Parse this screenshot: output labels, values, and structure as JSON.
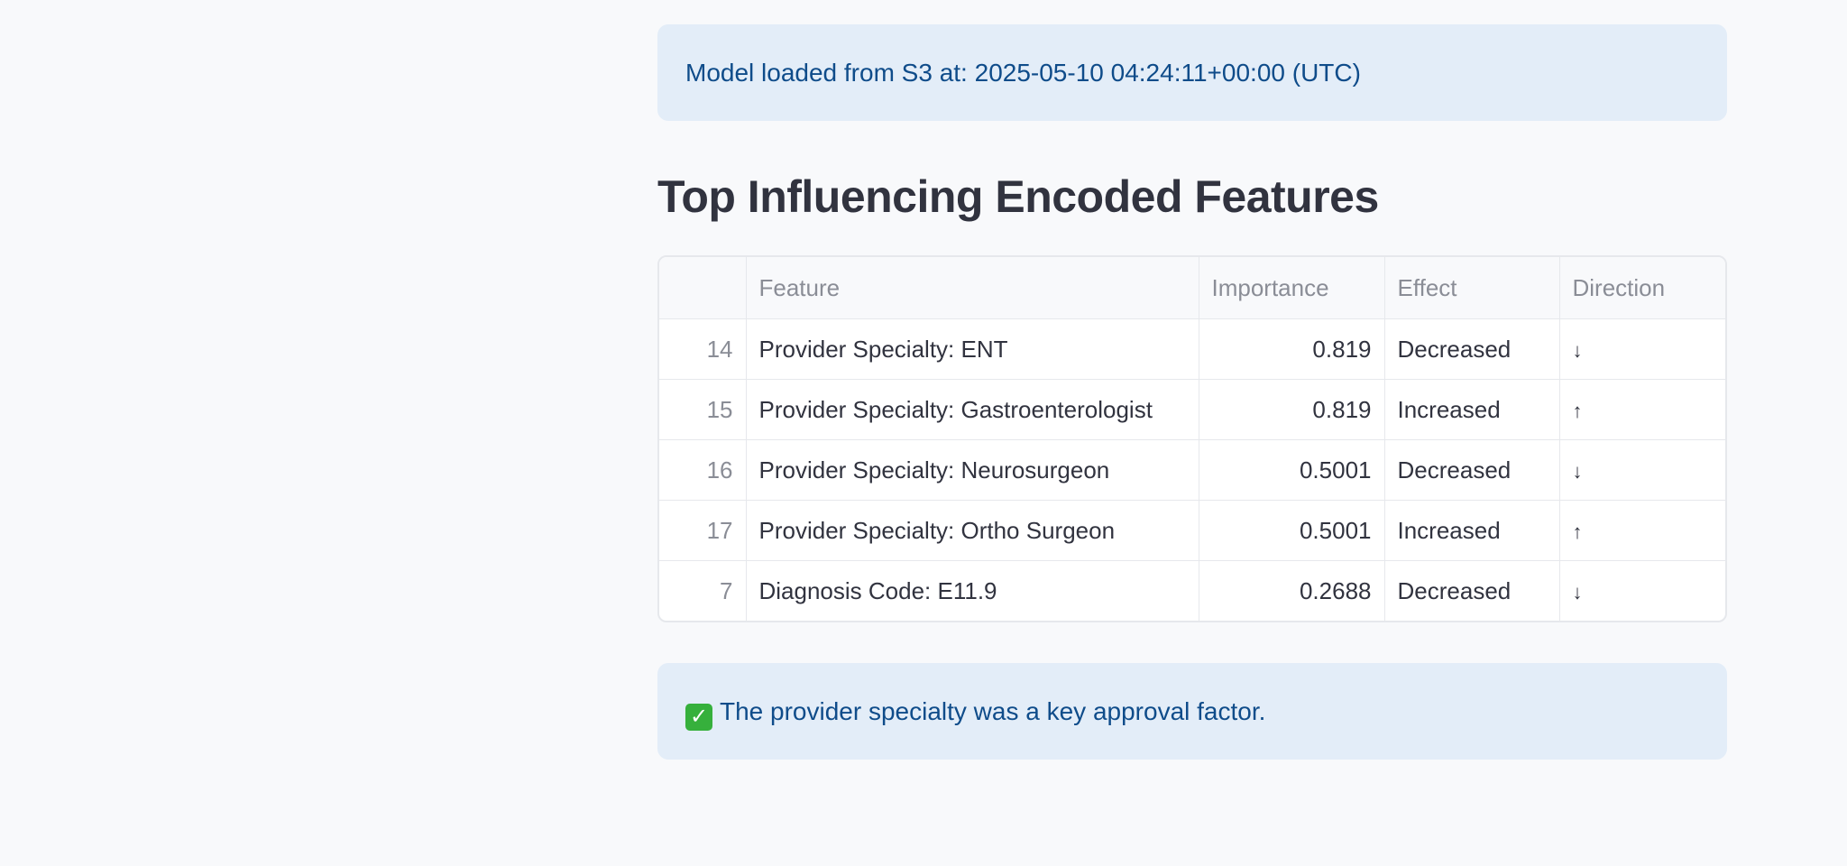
{
  "model_info": {
    "text": "Model loaded from S3 at: 2025-05-10 04:24:11+00:00 (UTC)"
  },
  "section": {
    "title": "Top Influencing Encoded Features"
  },
  "table": {
    "columns": [
      "",
      "Feature",
      "Importance",
      "Effect",
      "Direction"
    ],
    "rows": [
      {
        "index": "14",
        "feature": "Provider Specialty: ENT",
        "importance": "0.819",
        "effect": "Decreased",
        "direction": "↓"
      },
      {
        "index": "15",
        "feature": "Provider Specialty: Gastroenterologist",
        "importance": "0.819",
        "effect": "Increased",
        "direction": "↑"
      },
      {
        "index": "16",
        "feature": "Provider Specialty: Neurosurgeon",
        "importance": "0.5001",
        "effect": "Decreased",
        "direction": "↓"
      },
      {
        "index": "17",
        "feature": "Provider Specialty: Ortho Surgeon",
        "importance": "0.5001",
        "effect": "Increased",
        "direction": "↑"
      },
      {
        "index": "7",
        "feature": "Diagnosis Code: E11.9",
        "importance": "0.2688",
        "effect": "Decreased",
        "direction": "↓"
      }
    ]
  },
  "result": {
    "icon": "check-mark-icon",
    "text": "The provider specialty was a key approval factor."
  },
  "colors": {
    "alert_bg": "#e3edf8",
    "alert_text": "#0f4c8a",
    "check_green": "#36b03c"
  }
}
